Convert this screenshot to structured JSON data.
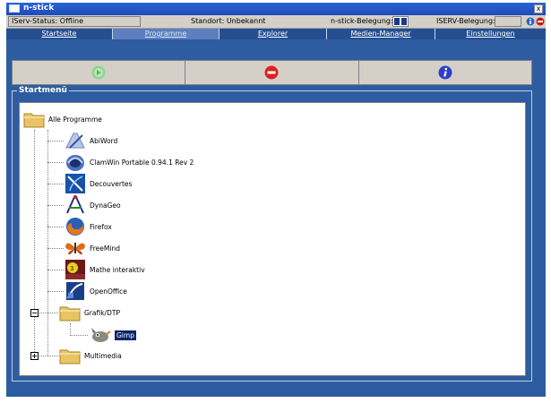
{
  "window": {
    "title": "n-stick",
    "close_label": "x"
  },
  "status": {
    "iserv_status": "IServ-Status: Offline",
    "standort": "Standort: Unbekannt",
    "nstick_label": "n-stick-Belegung:",
    "iserv_label": "ISERV-Belegung:"
  },
  "tabs": [
    {
      "label": "Startseite"
    },
    {
      "label": "Programme"
    },
    {
      "label": "Explorer"
    },
    {
      "label": "Medien-Manager"
    },
    {
      "label": "Einstellungen"
    }
  ],
  "startmenu": {
    "title": "Startmenü",
    "root": "Alle Programme",
    "items": [
      {
        "label": "AbiWord",
        "icon": "abiword-icon"
      },
      {
        "label": "ClamWin Portable 0.94.1 Rev 2",
        "icon": "clamwin-icon"
      },
      {
        "label": "Decouvertes",
        "icon": "decouvertes-icon"
      },
      {
        "label": "DynaGeo",
        "icon": "dynageo-icon"
      },
      {
        "label": "Firefox",
        "icon": "firefox-icon"
      },
      {
        "label": "FreeMind",
        "icon": "freemind-icon"
      },
      {
        "label": "Mathe interaktiv",
        "icon": "mathe-icon"
      },
      {
        "label": "OpenOffice",
        "icon": "openoffice-icon"
      }
    ],
    "folder_grafik": {
      "label": "Grafik/DTP",
      "child": "Gimp"
    },
    "folder_multimedia": {
      "label": "Multimedia"
    }
  },
  "colors": {
    "window_bg": "#2d5da0",
    "tab_bg": "#264f91",
    "title_bg": "#2a64d8",
    "selection": "#0a246a"
  }
}
